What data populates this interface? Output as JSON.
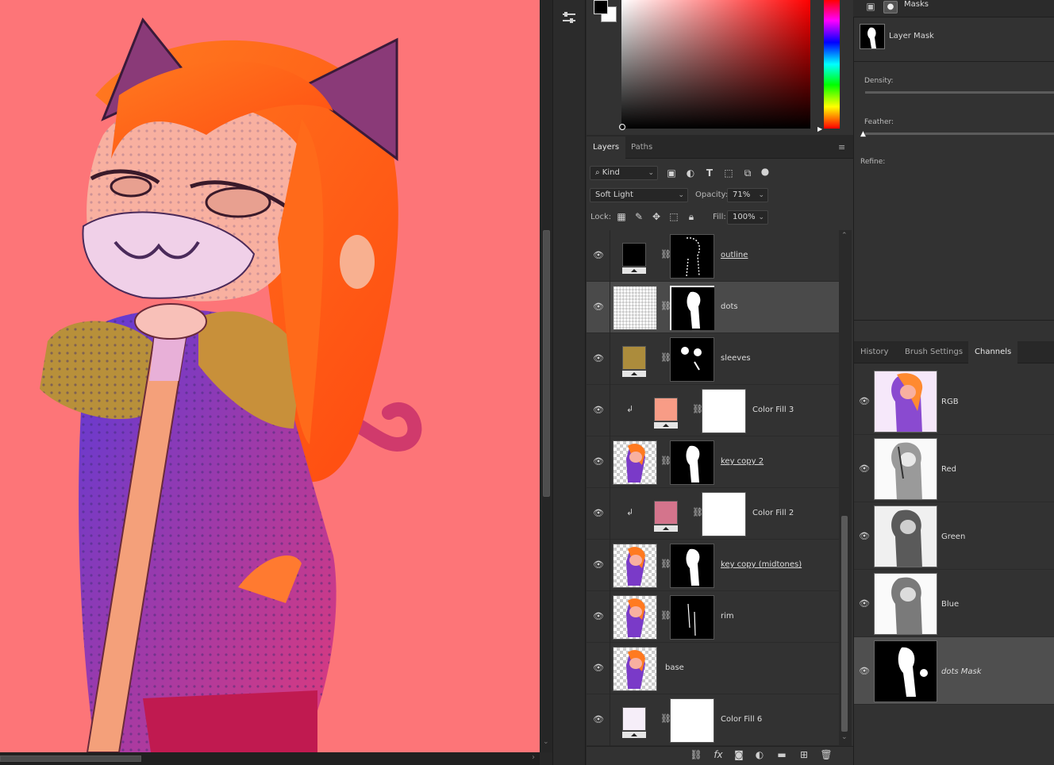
{
  "colors": {
    "canvas_bg": "#fd7578",
    "panel_bg": "#323232",
    "selected_row": "#4a4a4a"
  },
  "toolbar": {
    "adjust_icon": "sliders-icon"
  },
  "layers_panel": {
    "tabs": [
      "Layers",
      "Paths"
    ],
    "filter_label": "Kind",
    "blend_mode": "Soft Light",
    "opacity_label": "Opacity:",
    "opacity_value": "71%",
    "lock_label": "Lock:",
    "fill_label": "Fill:",
    "fill_value": "100%",
    "layers": [
      {
        "name": "outline",
        "selected": false,
        "underlined": true,
        "clipped": false,
        "thumb": "black",
        "mask": "outline"
      },
      {
        "name": "dots",
        "selected": true,
        "underlined": false,
        "clipped": false,
        "thumb": "checker",
        "mask": "figure"
      },
      {
        "name": "sleeves",
        "selected": false,
        "underlined": false,
        "clipped": false,
        "thumb": "#ac8c3c",
        "mask": "sleeves"
      },
      {
        "name": "Color Fill 3",
        "selected": false,
        "underlined": false,
        "clipped": true,
        "thumb": "#f89c86",
        "mask": "white"
      },
      {
        "name": "key copy 2",
        "selected": false,
        "underlined": true,
        "clipped": false,
        "thumb": "art",
        "mask": "figure"
      },
      {
        "name": "Color Fill 2",
        "selected": false,
        "underlined": false,
        "clipped": true,
        "thumb": "#d4748c",
        "mask": "white"
      },
      {
        "name": "key copy (midtones)",
        "selected": false,
        "underlined": true,
        "clipped": false,
        "thumb": "art",
        "mask": "figure"
      },
      {
        "name": "rim",
        "selected": false,
        "underlined": false,
        "clipped": false,
        "thumb": "art",
        "mask": "rim"
      },
      {
        "name": "base",
        "selected": false,
        "underlined": false,
        "clipped": false,
        "thumb": "art",
        "mask": "none"
      },
      {
        "name": "Color Fill 6",
        "selected": false,
        "underlined": false,
        "clipped": false,
        "thumb": "#f6eef9",
        "mask": "white"
      }
    ]
  },
  "properties": {
    "title": "Masks",
    "mask_type": "Layer Mask",
    "density_label": "Density:",
    "feather_label": "Feather:",
    "refine_label": "Refine:"
  },
  "channels_panel": {
    "tabs": [
      "History",
      "Brush Settings",
      "Channels"
    ],
    "channels": [
      {
        "name": "RGB",
        "selected": false,
        "italic": false
      },
      {
        "name": "Red",
        "selected": false,
        "italic": false
      },
      {
        "name": "Green",
        "selected": false,
        "italic": false
      },
      {
        "name": "Blue",
        "selected": false,
        "italic": false
      },
      {
        "name": "dots Mask",
        "selected": true,
        "italic": true
      }
    ]
  }
}
